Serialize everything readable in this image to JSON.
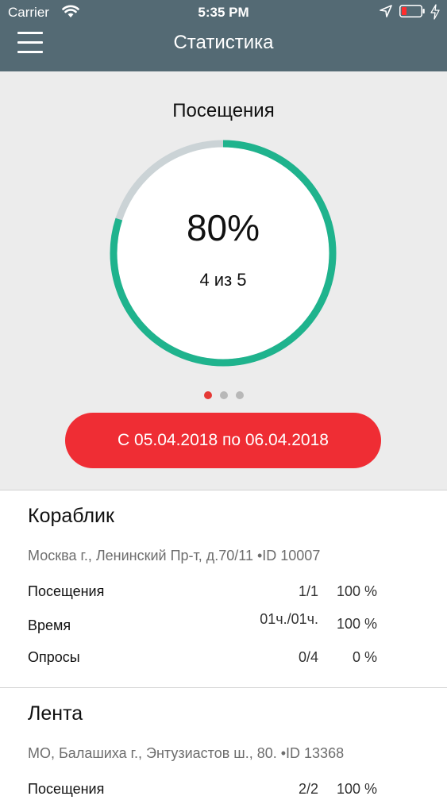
{
  "status_bar": {
    "carrier": "Carrier",
    "time": "5:35 PM"
  },
  "header": {
    "title": "Статистика"
  },
  "visits_chart": {
    "title": "Посещения",
    "percent_label": "80%",
    "count_label": "4 из 5",
    "progress": 0.8,
    "colors": {
      "filled": "#1fb38d",
      "empty": "#cbd3d6"
    }
  },
  "pager": {
    "active_index": 0,
    "total": 3
  },
  "date_range_button": {
    "label": "С 05.04.2018 по 06.04.2018",
    "color": "#ef2d34"
  },
  "venues": [
    {
      "name": "Кораблик",
      "address": "Москва г., Ленинский Пр-т, д.70/11 •ID 10007",
      "stats": [
        {
          "label": "Посещения",
          "value": "1/1",
          "percent": "100 %"
        },
        {
          "label": "Время",
          "value": "01ч./01ч.",
          "percent": "100 %"
        },
        {
          "label": "Опросы",
          "value": "0/4",
          "percent": "0 %"
        }
      ]
    },
    {
      "name": "Лента",
      "address": "МО, Балашиха г.,  Энтузиастов ш., 80. •ID 13368",
      "stats": [
        {
          "label": "Посещения",
          "value": "2/2",
          "percent": "100 %"
        }
      ]
    }
  ]
}
